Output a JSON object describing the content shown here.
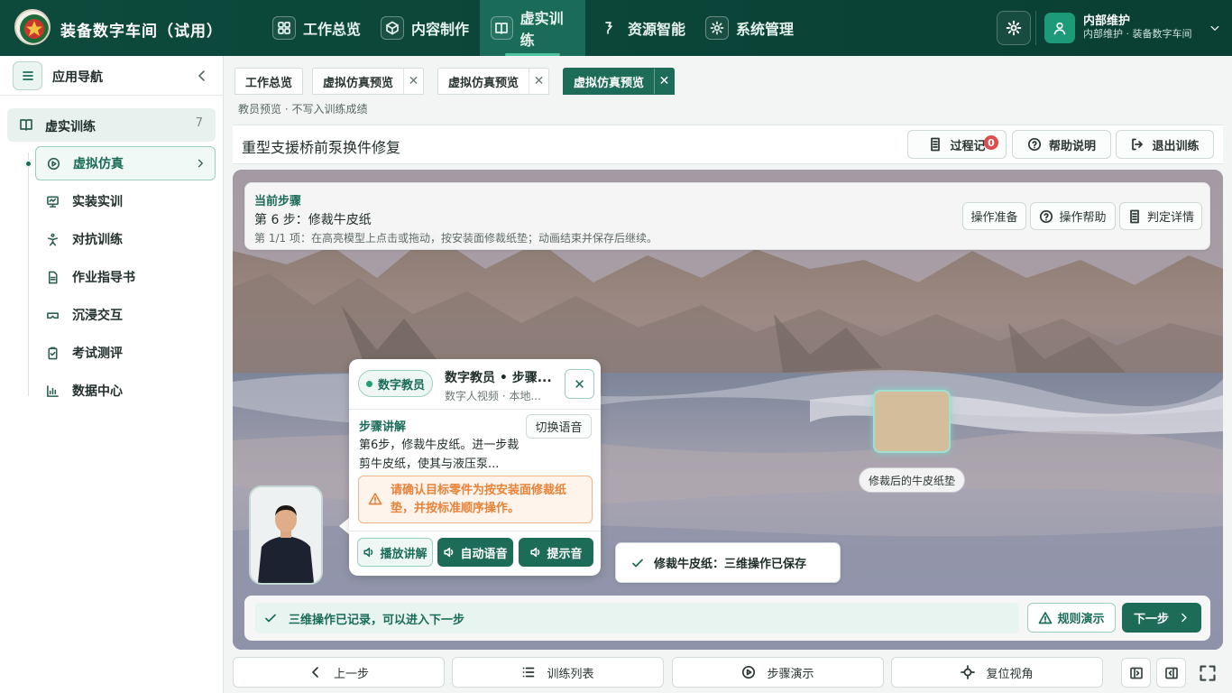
{
  "app": {
    "title": "装备数字车间（试用）"
  },
  "nav": [
    {
      "label": "工作总览",
      "icon": "grid-icon"
    },
    {
      "label": "内容制作",
      "icon": "cube-icon"
    },
    {
      "label": "虚实训练",
      "icon": "book-icon",
      "active": true
    },
    {
      "label": "资源智能",
      "icon": "hook-icon"
    },
    {
      "label": "系统管理",
      "icon": "gear-icon"
    }
  ],
  "user": {
    "name": "内部维护",
    "subtitle": "内部维护 · 装备数字车间"
  },
  "sidebar": {
    "title": "应用导航",
    "group": {
      "label": "虚实训练",
      "count": "7"
    },
    "items": [
      {
        "label": "虚拟仿真",
        "icon": "play-circle-icon"
      },
      {
        "label": "实装实训",
        "icon": "monitor-icon"
      },
      {
        "label": "对抗训练",
        "icon": "fight-icon"
      },
      {
        "label": "作业指导书",
        "icon": "document-icon"
      },
      {
        "label": "沉浸交互",
        "icon": "vr-headset-icon"
      },
      {
        "label": "考试测评",
        "icon": "exam-icon"
      },
      {
        "label": "数据中心",
        "icon": "chart-icon"
      }
    ]
  },
  "tabs": [
    {
      "label": "工作总览"
    },
    {
      "label": "虚拟仿真预览"
    },
    {
      "label": "虚拟仿真预览"
    },
    {
      "label": "虚拟仿真预览",
      "active": true
    }
  ],
  "page": {
    "notice": "教员预览 · 不写入训练成绩",
    "title": "重型支援桥前泵换件修复",
    "actions": {
      "process": "过程记",
      "process_badge": "0",
      "help": "帮助说明",
      "exit": "退出训练"
    }
  },
  "step": {
    "heading": "当前步骤",
    "title": "第 6 步：修裁牛皮纸",
    "detail": "第 1/1 项：在高亮模型上点击或拖动，按安装面修裁纸垫；动画结束并保存后继续。",
    "buttons": {
      "prepare": "操作准备",
      "help": "操作帮助",
      "judge": "判定详情"
    }
  },
  "instructor": {
    "chip": "数字教员",
    "title": "数字教员 • 步骤...",
    "subtitle": "数字人视频 · 本地...",
    "section": "步骤讲解",
    "switch_voice": "切换语音",
    "text": "第6步，修裁牛皮纸。进一步裁剪牛皮纸，使其与液压泵...",
    "warning": "请确认目标零件为按安装面修裁纸垫，并按标准顺序操作。",
    "play": "播放讲解",
    "auto_voice": "自动语音",
    "tone": "提示音"
  },
  "scene": {
    "part_label": "修裁后的牛皮纸垫",
    "toast": "修裁牛皮纸：三维操作已保存",
    "status": "三维操作已记录，可以进入下一步",
    "rule_demo": "规则演示",
    "next": "下一步"
  },
  "footer": {
    "prev": "上一步",
    "list": "训练列表",
    "demo": "步骤演示",
    "reset": "复位视角"
  },
  "colors": {
    "primary": "#1d6c58",
    "topbar": "#0d4a3c",
    "badge": "#e04b4b",
    "warning": "#e8833a"
  }
}
